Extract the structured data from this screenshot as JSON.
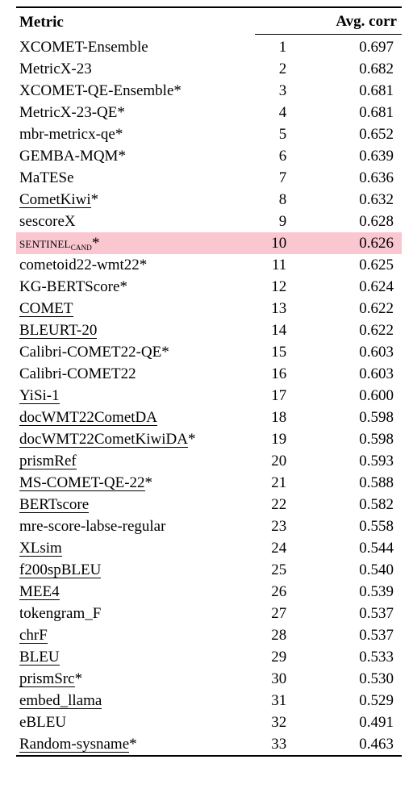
{
  "header": {
    "metric_label": "Metric",
    "avg_label": "Avg. corr"
  },
  "highlight_rank": 10,
  "rows": [
    {
      "name": "XCOMET-Ensemble",
      "rank": 1,
      "corr": "0.697",
      "under": false
    },
    {
      "name": "MetricX-23",
      "rank": 2,
      "corr": "0.682",
      "under": false
    },
    {
      "name": "XCOMET-QE-Ensemble*",
      "rank": 3,
      "corr": "0.681",
      "under": false
    },
    {
      "name": "MetricX-23-QE*",
      "rank": 4,
      "corr": "0.681",
      "under": false
    },
    {
      "name": "mbr-metricx-qe*",
      "rank": 5,
      "corr": "0.652",
      "under": false
    },
    {
      "name": "GEMBA-MQM*",
      "rank": 6,
      "corr": "0.639",
      "under": false
    },
    {
      "name": "MaTESe",
      "rank": 7,
      "corr": "0.636",
      "under": false
    },
    {
      "name": "CometKiwi*",
      "name_nostar": "CometKiwi",
      "rank": 8,
      "corr": "0.632",
      "under": true,
      "star": true
    },
    {
      "name": "sescoreX",
      "rank": 9,
      "corr": "0.628",
      "under": false
    },
    {
      "name": "SENTINEL_CAND*",
      "rank": 10,
      "corr": "0.626",
      "special": "sentinel"
    },
    {
      "name": "cometoid22-wmt22*",
      "rank": 11,
      "corr": "0.625",
      "under": false
    },
    {
      "name": "KG-BERTScore*",
      "rank": 12,
      "corr": "0.624",
      "under": false
    },
    {
      "name": "COMET",
      "rank": 13,
      "corr": "0.622",
      "under": true
    },
    {
      "name": "BLEURT-20",
      "rank": 14,
      "corr": "0.622",
      "under": true
    },
    {
      "name": "Calibri-COMET22-QE*",
      "rank": 15,
      "corr": "0.603",
      "under": false
    },
    {
      "name": "Calibri-COMET22",
      "rank": 16,
      "corr": "0.603",
      "under": false
    },
    {
      "name": "YiSi-1",
      "rank": 17,
      "corr": "0.600",
      "under": true
    },
    {
      "name": "docWMT22CometDA",
      "rank": 18,
      "corr": "0.598",
      "under": true
    },
    {
      "name": "docWMT22CometKiwiDA*",
      "name_nostar": "docWMT22CometKiwiDA",
      "rank": 19,
      "corr": "0.598",
      "under": true,
      "star": true
    },
    {
      "name": "prismRef",
      "rank": 20,
      "corr": "0.593",
      "under": true
    },
    {
      "name": "MS-COMET-QE-22*",
      "name_nostar": "MS-COMET-QE-22",
      "rank": 21,
      "corr": "0.588",
      "under": true,
      "star": true
    },
    {
      "name": "BERTscore",
      "rank": 22,
      "corr": "0.582",
      "under": true
    },
    {
      "name": "mre-score-labse-regular",
      "rank": 23,
      "corr": "0.558",
      "under": false
    },
    {
      "name": "XLsim",
      "rank": 24,
      "corr": "0.544",
      "under": true
    },
    {
      "name": "f200spBLEU",
      "rank": 25,
      "corr": "0.540",
      "under": true
    },
    {
      "name": "MEE4",
      "rank": 26,
      "corr": "0.539",
      "under": true
    },
    {
      "name": "tokengram_F",
      "rank": 27,
      "corr": "0.537",
      "under": false
    },
    {
      "name": "chrF",
      "rank": 28,
      "corr": "0.537",
      "under": true
    },
    {
      "name": "BLEU",
      "rank": 29,
      "corr": "0.533",
      "under": true
    },
    {
      "name": "prismSrc*",
      "name_nostar": "prismSrc",
      "rank": 30,
      "corr": "0.530",
      "under": true,
      "star": true
    },
    {
      "name": "embed_llama",
      "rank": 31,
      "corr": "0.529",
      "under": true
    },
    {
      "name": "eBLEU",
      "rank": 32,
      "corr": "0.491",
      "under": false
    },
    {
      "name": "Random-sysname*",
      "name_nostar": "Random-sysname",
      "rank": 33,
      "corr": "0.463",
      "under": true,
      "star": true
    }
  ]
}
